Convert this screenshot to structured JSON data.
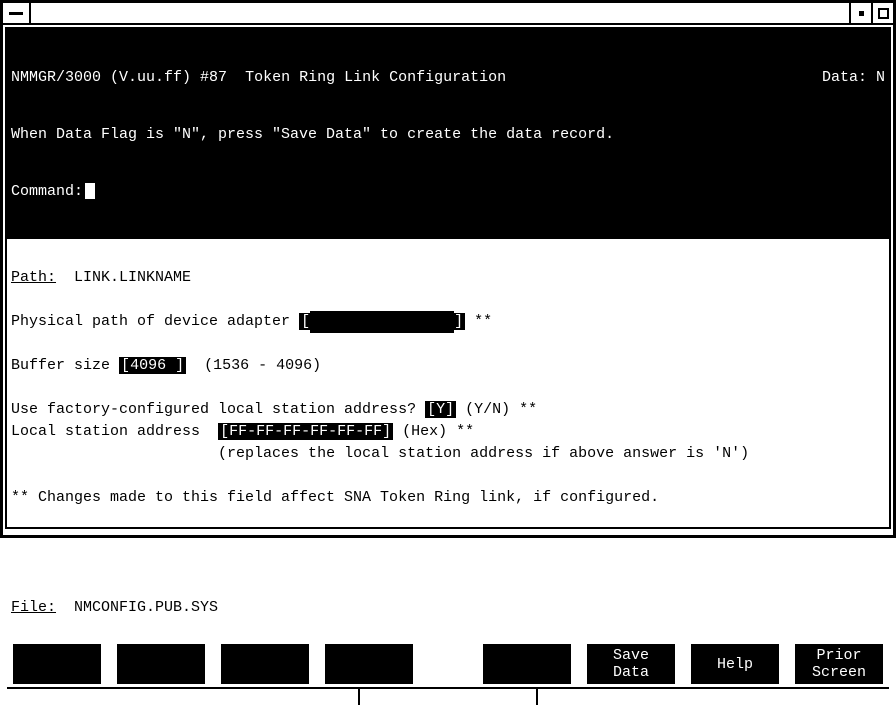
{
  "header": {
    "app": "NMMGR/3000 (V.uu.ff) #87",
    "title": "Token Ring Link Configuration",
    "data_label": "Data:",
    "data_value": "N",
    "hint": "When Data Flag is \"N\", press \"Save Data\" to create the data record.",
    "command_label": "Command:"
  },
  "path": {
    "label": "Path:",
    "value": "LINK.LINKNAME"
  },
  "fields": {
    "phys_path_label": "Physical path of device adapter",
    "phys_path_value": "                ",
    "phys_path_suffix": "**",
    "buffer_label": "Buffer size",
    "buffer_value": "4096 ",
    "buffer_range": "(1536 - 4096)",
    "factory_label": "Use factory-configured local station address?",
    "factory_value": "Y",
    "factory_suffix": "(Y/N) **",
    "local_addr_label": "Local station address ",
    "local_addr_value": "FF-FF-FF-FF-FF-FF",
    "local_addr_suffix": "(Hex) **",
    "local_addr_note": "(replaces the local station address if above answer is 'N')",
    "changes_note": "** Changes made to this field affect SNA Token Ring link, if configured."
  },
  "file": {
    "label": "File:",
    "value": "NMCONFIG.PUB.SYS"
  },
  "fkeys": {
    "f1": "",
    "f2": "",
    "f3": "",
    "f4": "",
    "f5": "",
    "f6_l1": "Save",
    "f6_l2": "Data",
    "f7": "Help",
    "f8_l1": "Prior",
    "f8_l2": "Screen"
  }
}
